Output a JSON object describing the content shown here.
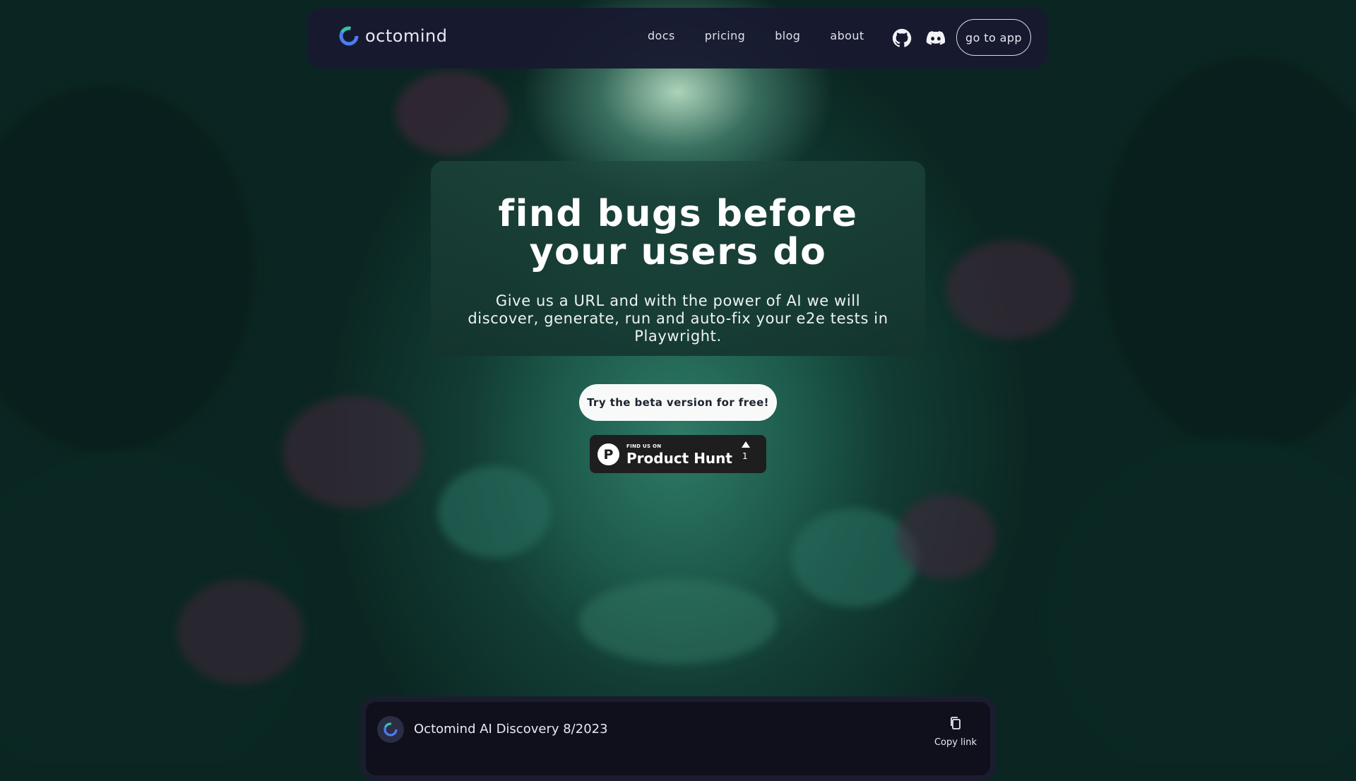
{
  "nav": {
    "logo_text": "octomind",
    "links": [
      "docs",
      "pricing",
      "blog",
      "about"
    ],
    "github_icon": "github-icon",
    "discord_icon": "discord-icon",
    "go_to_app": "go to app"
  },
  "hero": {
    "title": "find bugs before your users do",
    "subtitle": "Give us a URL and with the power of AI we will discover, generate, run and auto-fix your e2e tests in Playwright."
  },
  "cta": {
    "label": "Try the beta version for free!"
  },
  "product_hunt": {
    "small": "FIND US ON",
    "name": "Product Hunt",
    "count": "1",
    "logo_letter": "P"
  },
  "video": {
    "title": "Octomind AI Discovery 8/2023",
    "copy_label": "Copy link",
    "copy_icon": "copy-icon"
  },
  "colors": {
    "nav_bg": "#181a30",
    "accent_blue": "#4d7cf0",
    "accent_teal": "#34c2a6"
  }
}
